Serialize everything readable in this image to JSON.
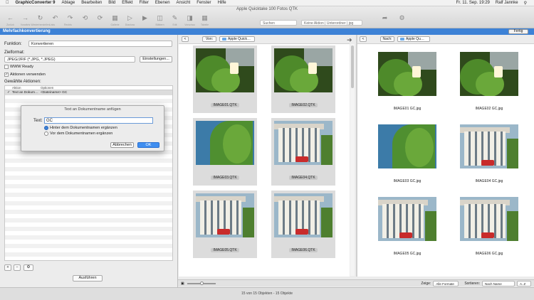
{
  "menubar": {
    "app": "GraphicConverter 9",
    "items": [
      "Ablage",
      "Bearbeiten",
      "Bild",
      "Effekt",
      "Filter",
      "Ebenen",
      "Ansicht",
      "Fenster",
      "Hilfe"
    ],
    "user": "Ralf Jannke",
    "datetime": "Fr. 11. Sep. 19:29"
  },
  "toolbar": {
    "window_title": "Apple Quicktake 100 Fotos QTK",
    "search_placeholder": "Suchen",
    "action_field": "Keine Aktion | Unterordner | jpg",
    "tools": [
      "Zurück",
      "Vorwärts",
      "Wiederherstellen",
      "Links drehen",
      "Rechts drehen",
      "Gallerie",
      "Diashow",
      "Diashow starten",
      "Blättern",
      "Edit",
      "Vorschau",
      "Tabelle"
    ]
  },
  "header": {
    "title": "Mehrfachkonvertierung",
    "done_label": "Fertig"
  },
  "left": {
    "function_label": "Funktion:",
    "function_value": "Konvertieren",
    "format_label": "Zielformat:",
    "format_value": "JPEG/JFIF (*.JPG, *.JPEG)",
    "settings_btn": "Einstellungen...",
    "www_ready": "WWW Ready",
    "use_actions": "Aktionen verwenden",
    "selected_actions": "Gewählte Aktionen:",
    "col_action": "Aktion",
    "col_options": "Optionen",
    "row_action": "Text an Dokum…",
    "row_options": "<Dateiname> GC",
    "run_btn": "Ausführen"
  },
  "dialog": {
    "title": "Text an Dokumentname anfügen",
    "text_label": "Text:",
    "text_value": "GC",
    "opt_after": "Hinter dem Dokumentnamen ergänzen",
    "opt_before": "Vor dem Dokumentnamen ergänzen",
    "cancel": "Abbrechen",
    "ok": "OK"
  },
  "source": {
    "nav_label": "Von:",
    "folder": "Apple Quick…",
    "files": [
      "IMAGE01.QTK",
      "IMAGE02.QTK",
      "IMAGE03.QTK",
      "IMAGE04.QTK",
      "IMAGE05.QTK",
      "IMAGE06.QTK"
    ]
  },
  "dest": {
    "nav_label": "Nach:",
    "folder": "Apple Qu…",
    "files": [
      "IMAGE01 GC.jpg",
      "IMAGE02 GC.jpg",
      "IMAGE03 GC.jpg",
      "IMAGE04 GC.jpg",
      "IMAGE05 GC.jpg",
      "IMAGE06 GC.jpg"
    ]
  },
  "bottom": {
    "show_label": "Zeige:",
    "show_value": "Alle Formate",
    "sort_label": "Sortieren:",
    "sort_value": "Nach Name",
    "order_value": "A..Z"
  },
  "status": "15 von 15 Objekten - 15 Objekte"
}
